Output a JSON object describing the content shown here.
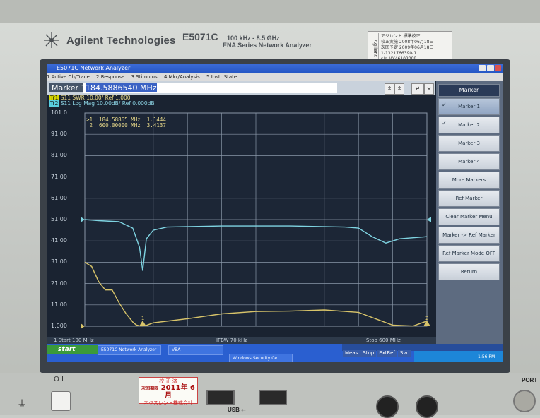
{
  "device": {
    "brand": "Agilent Technologies",
    "model": "E5071C",
    "range": "100 kHz - 8.5 GHz",
    "series": "ENA Series  Network Analyzer",
    "sticker_brand": "Agilent",
    "sticker_lines": [
      "アジレント 標準校正",
      "校正実施 2008年06月18日",
      "次回予定 2009年06月18日",
      "1-1321766390-1",
      "s/n MY46102099"
    ],
    "cal_stamp": {
      "title": "校 正 済",
      "date": "2011年 6月",
      "company": "ネクスレント株式会社",
      "side": "次回期限"
    },
    "usb_label": "USB",
    "port_label": "PORT",
    "power_label": "O I"
  },
  "window": {
    "title": "E5071C Network Analyzer",
    "menu": [
      "1 Active Ch/Trace",
      "2 Response",
      "3 Stimulus",
      "4 Mkr/Analysis",
      "5 Instr State"
    ],
    "entry_label": "Marker 1",
    "entry_value": "184.5886540 MHz"
  },
  "trace_info": {
    "tr1_badge": "Tr1",
    "tr1": "S11  SWR 10.00/ Ref 1.000",
    "tr2_badge": "Tr2",
    "tr2": "S11  Log Mag 10.00dB/ Ref 0.000dB"
  },
  "y_ticks": [
    "101.0",
    "91.00",
    "81.00",
    "71.00",
    "61.00",
    "51.00",
    "41.00",
    "31.00",
    "21.00",
    "11.00",
    "1.000"
  ],
  "marker_readout": [
    ">1  184.58865 MHz  1.1444",
    " 2  600.00000 MHz  3.4137"
  ],
  "status": {
    "start": "1  Start 100 MHz",
    "ifbw": "IFBW 70 kHz",
    "stop": "Stop 600 MHz"
  },
  "softkeys": {
    "title": "Marker",
    "items": [
      "Marker 1",
      "Marker 2",
      "Marker 3",
      "Marker 4",
      "More Markers",
      "Ref Marker",
      "Clear Marker Menu",
      "Marker -> Ref Marker",
      "Ref Marker Mode OFF",
      "Return"
    ]
  },
  "modebar": [
    "Meas",
    "Stop",
    "ExtRef",
    "Svc"
  ],
  "datetime": "2011-11-21 13:56",
  "taskbar": {
    "start": "start",
    "tasks": [
      "E5071C Network Analyzer",
      "VBA",
      "Windows Security Ce..."
    ],
    "clock": "1:56 PM"
  },
  "colors": {
    "trace_swr": "#d8c46a",
    "trace_logmag": "#7fd4e2",
    "grid": "#8a97a8"
  },
  "chart_data": {
    "type": "line",
    "x_unit": "MHz",
    "xlim": [
      100,
      600
    ],
    "series": [
      {
        "name": "S11 SWR",
        "x": [
          100,
          110,
          120,
          130,
          140,
          150,
          160,
          170,
          175,
          180,
          184.6,
          190,
          200,
          250,
          300,
          350,
          400,
          450,
          500,
          550,
          580,
          600
        ],
        "y": [
          31,
          29,
          22,
          18,
          18,
          12,
          7,
          3,
          1.6,
          1.2,
          1.1444,
          1.4,
          2.6,
          4.5,
          6.8,
          7.9,
          8.1,
          8.6,
          7.5,
          1.5,
          1.1,
          3.4137
        ]
      },
      {
        "name": "S11 Log Mag",
        "x": [
          100,
          120,
          150,
          170,
          180,
          184.6,
          190,
          200,
          220,
          300,
          400,
          480,
          500,
          520,
          540,
          560,
          600
        ],
        "y": [
          51,
          50.5,
          50,
          47,
          38,
          27,
          42,
          46,
          47.5,
          48,
          48,
          47.5,
          47,
          43,
          40,
          42,
          43
        ]
      }
    ],
    "markers": [
      {
        "id": "1",
        "x": 184.58865
      },
      {
        "id": "2",
        "x": 600
      }
    ]
  }
}
